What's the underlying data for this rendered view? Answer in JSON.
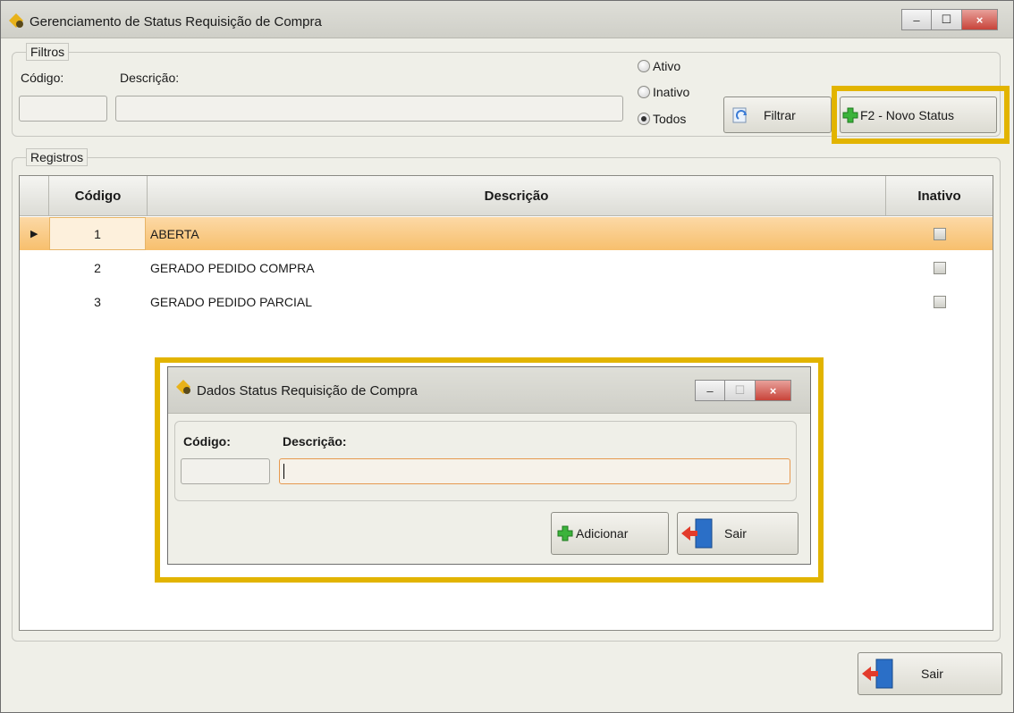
{
  "window": {
    "title": "Gerenciamento de Status Requisição de Compra",
    "controls": {
      "minimize": "–",
      "maximize": "☐",
      "close": "×"
    }
  },
  "filters": {
    "legend": "Filtros",
    "codigo_label": "Código:",
    "descricao_label": "Descrição:",
    "codigo_value": "",
    "descricao_value": "",
    "radio_options": [
      {
        "label": "Ativo",
        "checked": false
      },
      {
        "label": "Inativo",
        "checked": false
      },
      {
        "label": "Todos",
        "checked": true
      }
    ],
    "filter_button": "Filtrar",
    "new_status_button": "F2 - Novo Status"
  },
  "records": {
    "legend": "Registros",
    "columns": [
      "Código",
      "Descrição",
      "Inativo"
    ],
    "rows": [
      {
        "codigo": "1",
        "descricao": "ABERTA",
        "inativo": false,
        "selected": true
      },
      {
        "codigo": "2",
        "descricao": "GERADO PEDIDO COMPRA",
        "inativo": false,
        "selected": false
      },
      {
        "codigo": "3",
        "descricao": "GERADO PEDIDO PARCIAL",
        "inativo": false,
        "selected": false
      }
    ],
    "row_pointer": "▶"
  },
  "dialog": {
    "title": "Dados Status Requisição de Compra",
    "codigo_label": "Código:",
    "descricao_label": "Descrição:",
    "codigo_value": "",
    "descricao_value": "",
    "add_button": "Adicionar",
    "exit_button": "Sair"
  },
  "footer": {
    "exit_button": "Sair"
  },
  "colors": {
    "highlight": "#e2b400",
    "selected_row": "#f7bf6d"
  }
}
